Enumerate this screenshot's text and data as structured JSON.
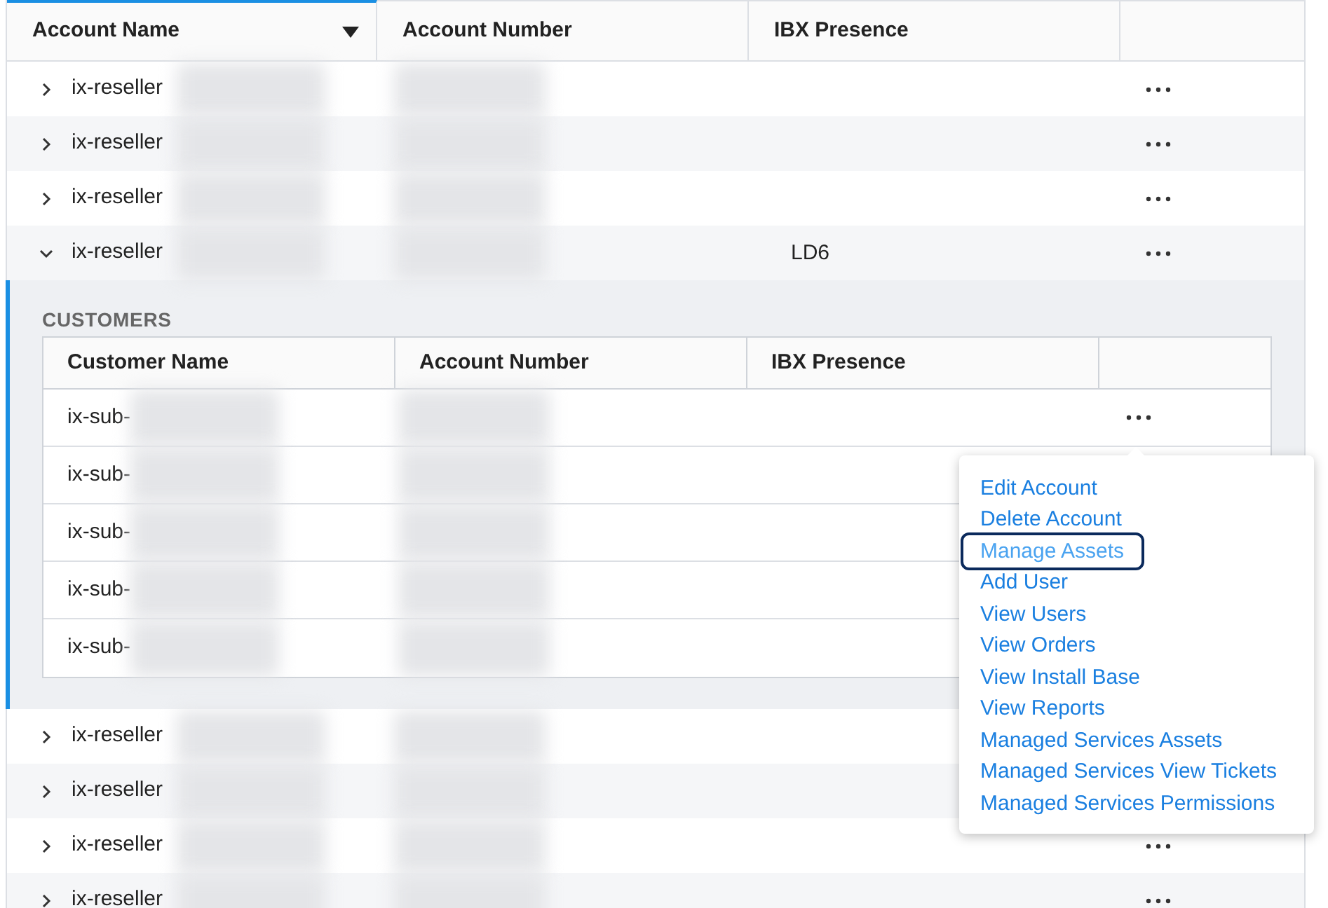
{
  "table": {
    "columns": [
      {
        "label": "Account Name",
        "sorted": true
      },
      {
        "label": "Account Number",
        "sorted": false
      },
      {
        "label": "IBX Presence",
        "sorted": false
      }
    ],
    "rows_before": [
      {
        "name": "ix-reseller",
        "expanded": false
      },
      {
        "name": "ix-reseller",
        "expanded": false
      },
      {
        "name": "ix-reseller",
        "expanded": false
      },
      {
        "name": "ix-reseller",
        "ibx": "LD6",
        "expanded": true
      }
    ],
    "customers": {
      "title": "CUSTOMERS",
      "columns": [
        "Customer Name",
        "Account Number",
        "IBX Presence"
      ],
      "rows": [
        {
          "name": "ix-sub-"
        },
        {
          "name": "ix-sub-"
        },
        {
          "name": "ix-sub-"
        },
        {
          "name": "ix-sub-"
        },
        {
          "name": "ix-sub-"
        }
      ]
    },
    "rows_after": [
      {
        "name": "ix-reseller",
        "expanded": false
      },
      {
        "name": "ix-reseller",
        "expanded": false
      },
      {
        "name": "ix-reseller",
        "expanded": false
      },
      {
        "name": "ix-reseller",
        "expanded": false
      }
    ]
  },
  "action_menu": {
    "items": [
      {
        "label": "Edit Account",
        "focused": false
      },
      {
        "label": "Delete Account",
        "focused": false
      },
      {
        "label": "Manage Assets",
        "focused": true
      },
      {
        "label": "Add User",
        "focused": false
      },
      {
        "label": "View Users",
        "focused": false
      },
      {
        "label": "View Orders",
        "focused": false
      },
      {
        "label": "View Install Base",
        "focused": false
      },
      {
        "label": "View Reports",
        "focused": false
      },
      {
        "label": "Managed Services Assets",
        "focused": false
      },
      {
        "label": "Managed Services View Tickets",
        "focused": false
      },
      {
        "label": "Managed Services Permissions",
        "focused": false
      }
    ]
  }
}
